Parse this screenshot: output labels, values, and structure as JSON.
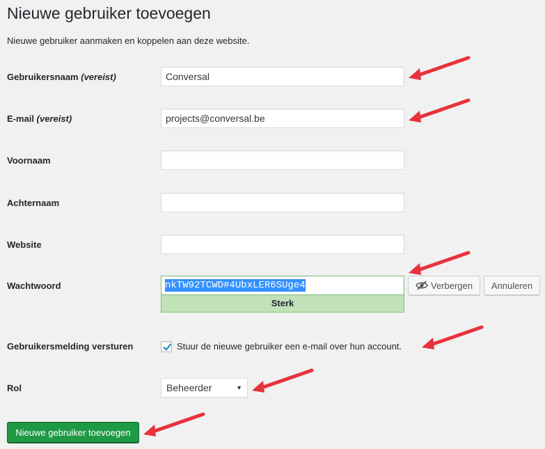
{
  "page": {
    "title": "Nieuwe gebruiker toevoegen",
    "description": "Nieuwe gebruiker aanmaken en koppelen aan deze website."
  },
  "form": {
    "username": {
      "label": "Gebruikersnaam",
      "required": "(vereist)",
      "value": "Conversal"
    },
    "email": {
      "label": "E-mail",
      "required": "(vereist)",
      "value": "projects@conversal.be"
    },
    "first_name": {
      "label": "Voornaam",
      "value": ""
    },
    "last_name": {
      "label": "Achternaam",
      "value": ""
    },
    "website": {
      "label": "Website",
      "value": ""
    },
    "password": {
      "label": "Wachtwoord",
      "value": "nkTW92TCWD#4UbxLER6SUge4",
      "strength": "Sterk",
      "hide_button": "Verbergen",
      "cancel_button": "Annuleren"
    },
    "notification": {
      "label": "Gebruikersmelding versturen",
      "checkbox_label": "Stuur de nieuwe gebruiker een e-mail over hun account.",
      "checked": true
    },
    "role": {
      "label": "Rol",
      "value": "Beheerder"
    },
    "submit": "Nieuwe gebruiker toevoegen"
  },
  "colors": {
    "accent_arrow": "#e8323c",
    "primary_button": "#1e9a44",
    "strength_bg": "#c1e1b9",
    "selection": "#3390ff"
  },
  "icons": [
    "eye-slash-icon",
    "checkmark-icon",
    "caret-down-icon",
    "arrow-icon"
  ]
}
